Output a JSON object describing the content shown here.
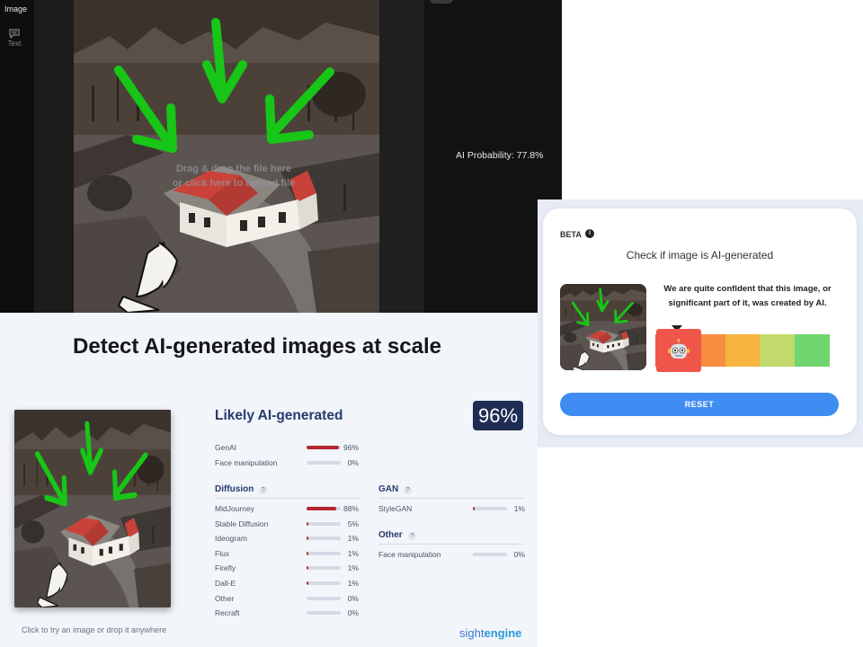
{
  "detector_app": {
    "sidebar": {
      "image_label": "Image",
      "text_label": "Text"
    },
    "drop_hint_line1": "Drag & drop the file here",
    "drop_hint_line2": "or click here to upload file",
    "ai_probability": "AI Probability: 77.8%"
  },
  "sightengine": {
    "headline": "Detect AI-generated images at scale",
    "thumb_caption": "Click to try an image or drop it anywhere",
    "result_title": "Likely AI-generated",
    "score": "96%",
    "top_rows": [
      {
        "name": "GenAI",
        "value": 96,
        "label": "96%"
      },
      {
        "name": "Face manipulation",
        "value": 0,
        "label": "0%"
      }
    ],
    "diffusion": {
      "title": "Diffusion",
      "help": "?",
      "rows": [
        {
          "name": "MidJourney",
          "value": 88,
          "label": "88%"
        },
        {
          "name": "Stable Diffusion",
          "value": 5,
          "label": "5%"
        },
        {
          "name": "Ideogram",
          "value": 1,
          "label": "1%"
        },
        {
          "name": "Flux",
          "value": 1,
          "label": "1%"
        },
        {
          "name": "Firefly",
          "value": 1,
          "label": "1%"
        },
        {
          "name": "Dall-E",
          "value": 1,
          "label": "1%"
        },
        {
          "name": "Other",
          "value": 0,
          "label": "0%"
        },
        {
          "name": "Recraft",
          "value": 0,
          "label": "0%"
        }
      ]
    },
    "gan": {
      "title": "GAN",
      "help": "?",
      "rows": [
        {
          "name": "StyleGAN",
          "value": 1,
          "label": "1%"
        }
      ]
    },
    "other": {
      "title": "Other",
      "help": "?",
      "rows": [
        {
          "name": "Face manipulation",
          "value": 0,
          "label": "0%"
        }
      ]
    },
    "brand_prefix": "sight",
    "brand_suffix": "engine",
    "colors": {
      "bar_fill": "#b3262d",
      "bar_track": "#d5dbe5",
      "badge": "#1f2d55",
      "title": "#263a6e"
    }
  },
  "beta_check": {
    "tag": "BETA",
    "info": "i",
    "title": "Check if image is AI-generated",
    "message": "We are quite confident that this image, or significant part of it, was created by AI.",
    "reset_label": "RESET",
    "scale_colors": [
      "#f0554a",
      "#f78d3f",
      "#f8b440",
      "#c2d96b",
      "#6fd66f"
    ],
    "colors": {
      "button": "#3f8cf2"
    }
  }
}
